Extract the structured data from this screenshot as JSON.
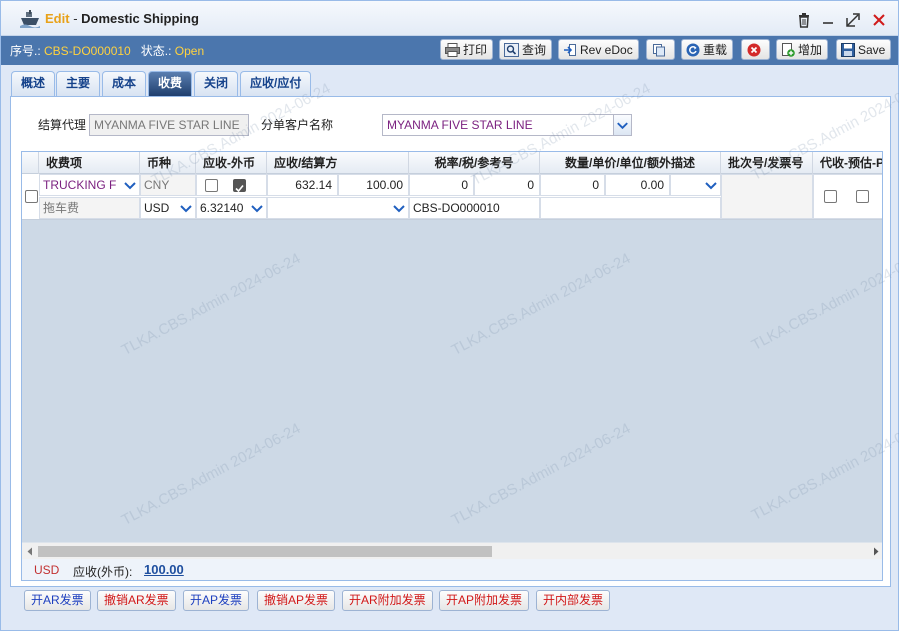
{
  "window": {
    "edit_label": "Edit",
    "separator": "-",
    "title": "Domestic Shipping"
  },
  "toolbar": {
    "serial_label": "序号.:",
    "serial_value": "CBS-DO000010",
    "status_label": "状态.:",
    "status_value": "Open",
    "buttons": {
      "print": "打印",
      "query": "查询",
      "rev_edoc": "Rev eDoc",
      "reload": "重载",
      "add": "增加",
      "save": "Save"
    }
  },
  "tabs": [
    "概述",
    "主要",
    "成本",
    "收费",
    "关闭",
    "应收/应付"
  ],
  "active_tab": "收费",
  "filter": {
    "agent_label": "结算代理",
    "agent_value": "MYANMA FIVE STAR LINE",
    "sub_customer_label": "分单客户名称",
    "sub_customer_value": "MYANMA FIVE STAR LINE"
  },
  "grid": {
    "columns": [
      "收费项",
      "币种",
      "应收-外币",
      "应收/结算方",
      "税率/税/参考号",
      "数量/单价/单位/额外描述",
      "批次号/发票号",
      "代收-预估-P"
    ],
    "row": {
      "charge_item": "TRUCKING F",
      "charge_desc": "拖车费",
      "currency_top": "CNY",
      "currency": "USD",
      "fx_rate": "6.32140",
      "amount_local": "632.14",
      "amount": "100.00",
      "tax_rate": "0",
      "tax": "0",
      "reference": "CBS-DO000010",
      "quantity": "0",
      "unit_price": "0.00"
    }
  },
  "summary": {
    "currency": "USD",
    "label": "应收(外币):",
    "value": "100.00"
  },
  "actions": [
    "开AR发票",
    "撤销AR发票",
    "开AP发票",
    "撤销AP发票",
    "开AR附加发票",
    "开AP附加发票",
    "开内部发票"
  ],
  "watermark": "TLKA.CBS.Admin 2024-06-24",
  "colors": {
    "toolbar_bg": "#4b76ad",
    "status_value": "#ffd23f",
    "active_tab": "#1f3f6e",
    "link_blue": "#1d3fbf",
    "action_red": "#d11818"
  }
}
